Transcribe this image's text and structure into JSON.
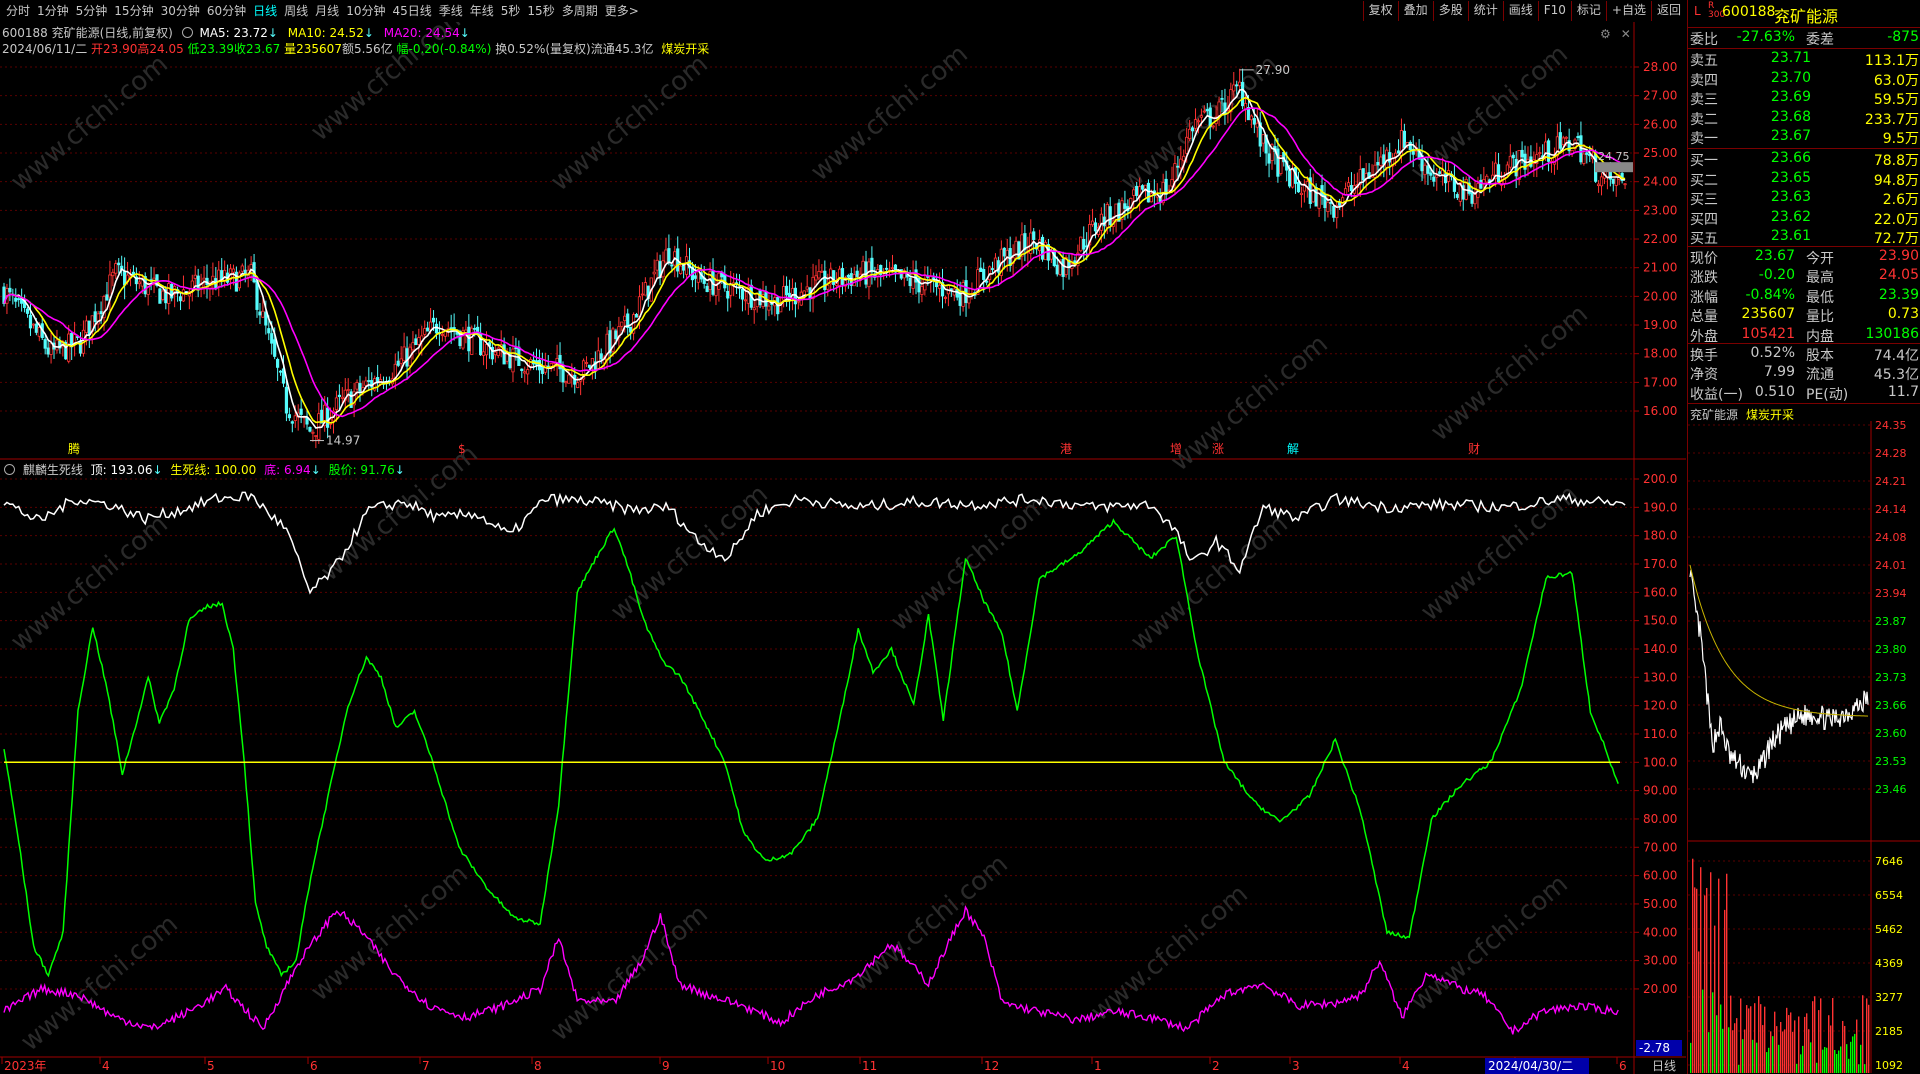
{
  "toolbar": {
    "periods": [
      "分时",
      "1分钟",
      "5分钟",
      "15分钟",
      "30分钟",
      "60分钟",
      "日线",
      "周线",
      "月线",
      "10分钟",
      "45日线",
      "季线",
      "年线",
      "5秒",
      "15秒",
      "多周期",
      "更多>"
    ],
    "active_period": "日线",
    "right_buttons": [
      "复权",
      "叠加",
      "多股",
      "统计",
      "画线",
      "F10",
      "标记",
      "+自选",
      "返回"
    ]
  },
  "main_chart": {
    "stock_line": "600188 兖矿能源(日线,前复权)",
    "ma5": "MA5: 23.72",
    "ma10": "MA10: 24.52",
    "ma20": "MA20: 24.54",
    "info_date": "2024/06/11/二",
    "info_open": "开23.90",
    "info_high": "高24.05",
    "info_low": "低23.39",
    "info_close": "收23.67",
    "info_vol": "量235607",
    "info_amount": "额5.56亿",
    "info_change": "幅-0.20(-0.84%)",
    "info_turnover": "换0.52%(量复权)",
    "info_float": "流通45.3亿",
    "info_sector": "煤炭开采",
    "price_ticks": [
      "28.00",
      "27.00",
      "26.00",
      "25.00",
      "24.00",
      "23.00",
      "22.00",
      "21.00",
      "20.00",
      "19.00",
      "18.00",
      "17.00",
      "16.00"
    ],
    "high_label": "27.90",
    "low_label": "14.97",
    "last_label": "24.75",
    "markers": [
      "腾",
      "$",
      "港",
      "增",
      "涨",
      "解",
      "财"
    ],
    "colors": {
      "up": "#ff3232",
      "down": "#54fcfc",
      "ma5": "#ffffff",
      "ma10": "#ffff00",
      "ma20": "#ff00ff"
    }
  },
  "indicator": {
    "name": "麒麟生死线",
    "top": "顶: 193.06",
    "line": "生死线: 100.00",
    "bottom": "底: 6.94",
    "price": "股价: 91.76",
    "ticks": [
      "200.0",
      "190.0",
      "180.0",
      "170.0",
      "160.0",
      "150.0",
      "140.0",
      "130.0",
      "120.0",
      "110.0",
      "100.0",
      "90.00",
      "80.00",
      "70.00",
      "60.00",
      "50.00",
      "40.00",
      "30.00",
      "20.00"
    ],
    "last_value": "-2.78",
    "colors": {
      "price_line": "#ffffff",
      "main_line": "#00ff00",
      "life_line": "#ffff00",
      "bottom_line": "#ff00ff"
    }
  },
  "date_axis": {
    "labels": [
      "2023年",
      "4",
      "5",
      "6",
      "7",
      "8",
      "9",
      "10",
      "11",
      "12",
      "1",
      "2",
      "3",
      "4",
      "5",
      "6"
    ],
    "highlight": "2024/04/30/二",
    "period_label": "日线"
  },
  "quote": {
    "code": "600188",
    "name": "兖矿能源",
    "weibi_label": "委比",
    "weibi": "-27.63%",
    "weicha_label": "委差",
    "weicha": "-875",
    "asks": [
      {
        "label": "卖五",
        "price": "23.71",
        "vol": "113.1万"
      },
      {
        "label": "卖四",
        "price": "23.70",
        "vol": "63.0万"
      },
      {
        "label": "卖三",
        "price": "23.69",
        "vol": "59.5万"
      },
      {
        "label": "卖二",
        "price": "23.68",
        "vol": "233.7万"
      },
      {
        "label": "卖一",
        "price": "23.67",
        "vol": "9.5万"
      }
    ],
    "bids": [
      {
        "label": "买一",
        "price": "23.66",
        "vol": "78.8万"
      },
      {
        "label": "买二",
        "price": "23.65",
        "vol": "94.8万"
      },
      {
        "label": "买三",
        "price": "23.63",
        "vol": "2.6万"
      },
      {
        "label": "买四",
        "price": "23.62",
        "vol": "22.0万"
      },
      {
        "label": "买五",
        "price": "23.61",
        "vol": "72.7万"
      }
    ],
    "stats": [
      {
        "l1": "现价",
        "v1": "23.67",
        "c1": "#00ff00",
        "l2": "今开",
        "v2": "23.90",
        "c2": "#ff3232"
      },
      {
        "l1": "涨跌",
        "v1": "-0.20",
        "c1": "#00ff00",
        "l2": "最高",
        "v2": "24.05",
        "c2": "#ff3232"
      },
      {
        "l1": "涨幅",
        "v1": "-0.84%",
        "c1": "#00ff00",
        "l2": "最低",
        "v2": "23.39",
        "c2": "#00ff00"
      },
      {
        "l1": "总量",
        "v1": "235607",
        "c1": "#ffff00",
        "l2": "量比",
        "v2": "0.73",
        "c2": "#ffff00"
      },
      {
        "l1": "外盘",
        "v1": "105421",
        "c1": "#ff3232",
        "l2": "内盘",
        "v2": "130186",
        "c2": "#00ff00"
      }
    ],
    "stats2": [
      {
        "l1": "换手",
        "v1": "0.52%",
        "l2": "股本",
        "v2": "74.4亿"
      },
      {
        "l1": "净资",
        "v1": "7.99",
        "l2": "流通",
        "v2": "45.3亿"
      },
      {
        "l1": "收益(一)",
        "v1": "0.510",
        "l2": "PE(动)",
        "v2": "11.7"
      }
    ],
    "mini_name": "兖矿能源",
    "mini_sector": "煤炭开采",
    "mini_price_ticks": [
      "24.35",
      "24.28",
      "24.21",
      "24.14",
      "24.08",
      "24.01",
      "23.94",
      "23.87",
      "23.80",
      "23.73",
      "23.66",
      "23.60",
      "23.53",
      "23.46"
    ],
    "mini_vol_ticks": [
      "7646",
      "6554",
      "5462",
      "4369",
      "3277",
      "2185",
      "1092"
    ]
  },
  "watermark": "www.cfchi.com"
}
